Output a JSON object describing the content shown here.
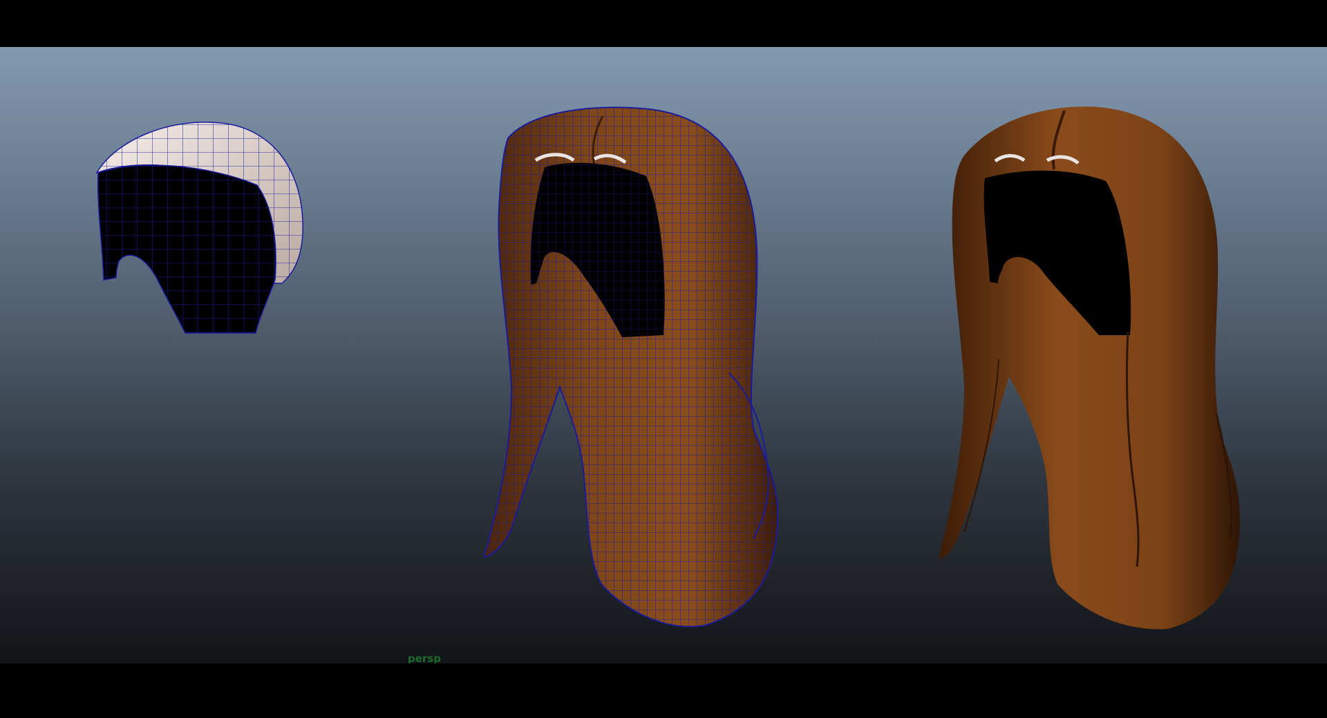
{
  "viewports": [
    {
      "id": "wireframe-cap",
      "camera": "persp"
    },
    {
      "id": "wireframe-long-hair",
      "camera": "persp"
    },
    {
      "id": "shaded-long-hair",
      "camera": "persp"
    }
  ],
  "colors": {
    "background_top": "#8399b0",
    "background_bottom": "#121417",
    "hair_brown": "#7a4218",
    "hair_dark": "#3a1c08",
    "wire_blue": "#1a1a9a",
    "cap_white": "#e9dcd6",
    "label_green": "#1e6a2a"
  }
}
